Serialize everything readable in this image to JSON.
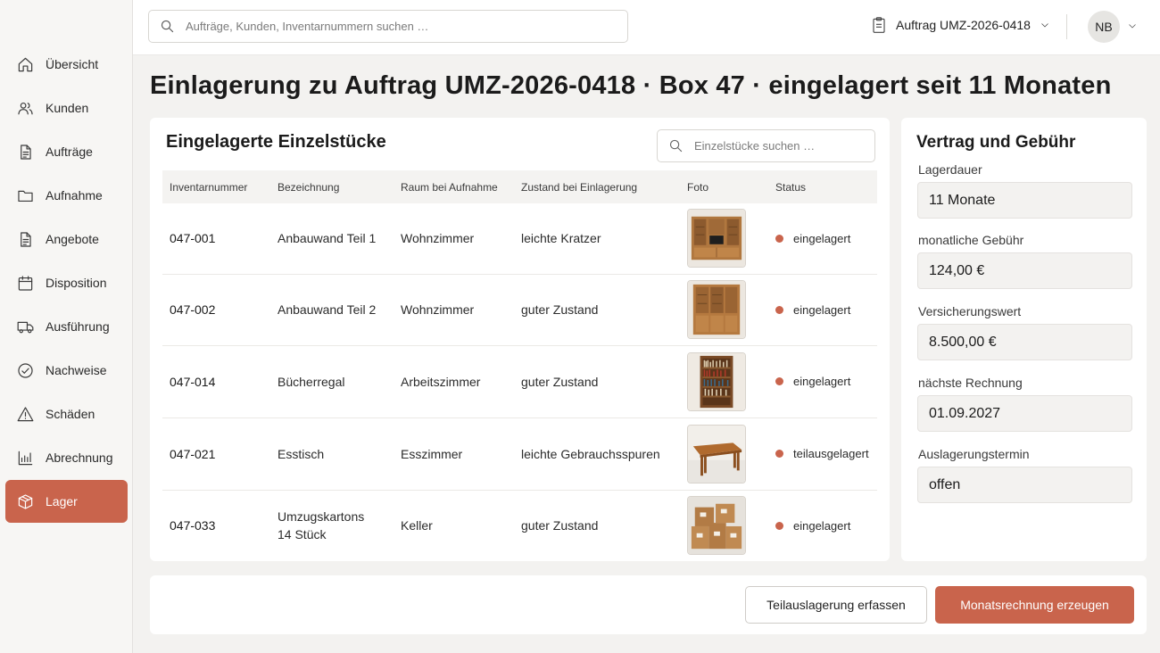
{
  "sidebar": {
    "items": [
      {
        "label": "Übersicht",
        "icon": "home-icon"
      },
      {
        "label": "Kunden",
        "icon": "users-icon"
      },
      {
        "label": "Aufträge",
        "icon": "document-icon"
      },
      {
        "label": "Aufnahme",
        "icon": "folder-icon"
      },
      {
        "label": "Angebote",
        "icon": "document-icon"
      },
      {
        "label": "Disposition",
        "icon": "calendar-icon"
      },
      {
        "label": "Ausführung",
        "icon": "truck-icon"
      },
      {
        "label": "Nachweise",
        "icon": "check-circle-icon"
      },
      {
        "label": "Schäden",
        "icon": "warning-icon"
      },
      {
        "label": "Abrechnung",
        "icon": "bar-chart-icon"
      },
      {
        "label": "Lager",
        "icon": "box-icon",
        "active": true
      }
    ]
  },
  "topbar": {
    "search_placeholder": "Aufträge, Kunden, Inventarnummern suchen …",
    "order_label": "Auftrag UMZ-2026-0418",
    "user_initials": "NB"
  },
  "page": {
    "title": "Einlagerung zu Auftrag UMZ-2026-0418 · Box 47 · eingelagert seit 11 Monaten"
  },
  "items": {
    "title": "Eingelagerte Einzelstücke",
    "search_placeholder": "Einzelstücke suchen …",
    "columns": [
      "Inventarnummer",
      "Bezeichnung",
      "Raum bei Aufnahme",
      "Zustand bei Einlagerung",
      "Foto",
      "Status"
    ],
    "rows": [
      {
        "inv": "047-001",
        "name": "Anbauwand Teil 1",
        "room": "Wohnzimmer",
        "condition": "leichte Kratzer",
        "photo": "wall-unit-tv",
        "status": "eingelagert"
      },
      {
        "inv": "047-002",
        "name": "Anbauwand Teil 2",
        "room": "Wohnzimmer",
        "condition": "guter Zustand",
        "photo": "wall-unit-cabinet",
        "status": "eingelagert"
      },
      {
        "inv": "047-014",
        "name": "Bücherregal",
        "room": "Arbeitszimmer",
        "condition": "guter Zustand",
        "photo": "bookshelf",
        "status": "eingelagert"
      },
      {
        "inv": "047-021",
        "name": "Esstisch",
        "room": "Esszimmer",
        "condition": "leichte Gebrauchsspuren",
        "photo": "dining-table",
        "status": "teilausgelagert"
      },
      {
        "inv": "047-033",
        "name": "Umzugskartons",
        "name_line2": "14 Stück",
        "room": "Keller",
        "condition": "guter Zustand",
        "photo": "moving-boxes",
        "status": "eingelagert"
      }
    ]
  },
  "contract": {
    "title": "Vertrag und Gebühr",
    "fields": [
      {
        "label": "Lagerdauer",
        "value": "11 Monate"
      },
      {
        "label": "monatliche Gebühr",
        "value": "124,00 €"
      },
      {
        "label": "Versicherungswert",
        "value": "8.500,00 €"
      },
      {
        "label": "nächste Rechnung",
        "value": "01.09.2027"
      },
      {
        "label": "Auslagerungstermin",
        "value": "offen"
      }
    ]
  },
  "actions": {
    "secondary": "Teilauslagerung erfassen",
    "primary": "Monatsrechnung erzeugen"
  },
  "colors": {
    "accent": "#c9644c",
    "background": "#f3f2f0",
    "card": "#ffffff"
  }
}
